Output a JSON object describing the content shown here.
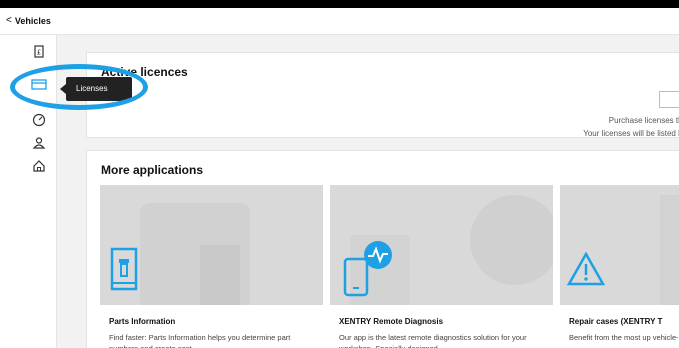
{
  "header": {
    "back_label": "Vehicles"
  },
  "sidebar": {
    "tooltip": "Licenses"
  },
  "licences": {
    "title": "Active licences",
    "empty_line1": "Purchase licenses tha",
    "empty_line2": "Your licenses will be listed he"
  },
  "more_apps": {
    "title": "More applications",
    "apps": [
      {
        "name": "Parts Information",
        "desc": "Find faster: Parts Information helps you determine part numbers and create cost",
        "icon": "parts-book-icon"
      },
      {
        "name": "XENTRY Remote Diagnosis",
        "desc": "Our app is the latest remote diagnostics solution for your workshop. Specially designed",
        "icon": "remote-diagnosis-icon"
      },
      {
        "name": "Repair cases (XENTRY T",
        "desc": "Benefit from the most up vehicle-related complaint",
        "icon": "warning-triangle-icon"
      }
    ]
  },
  "colors": {
    "accent": "#1ea1e4",
    "highlight_ring": "#1ea1e4"
  }
}
